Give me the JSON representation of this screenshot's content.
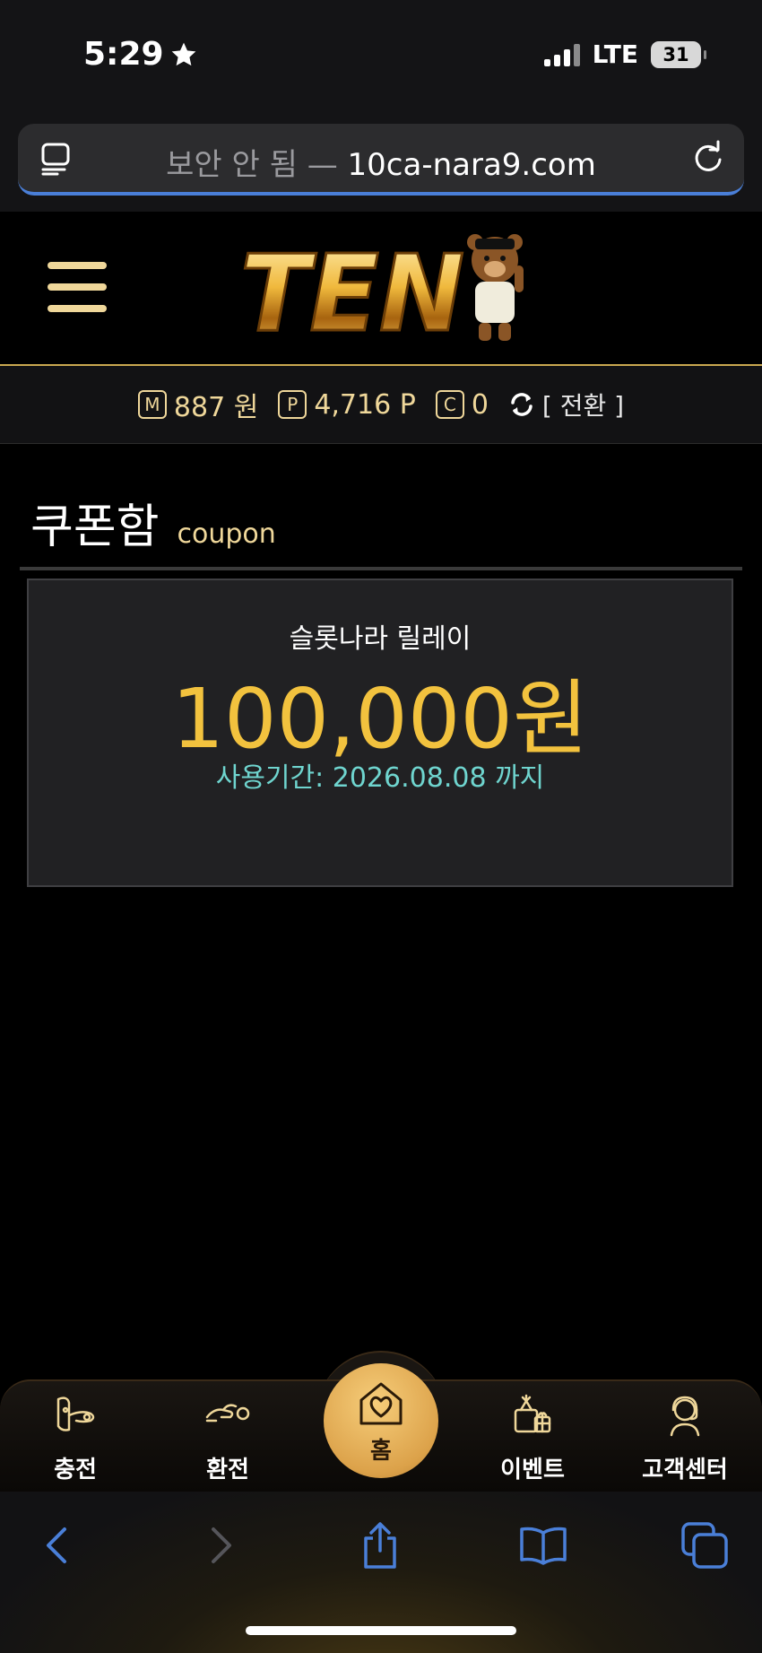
{
  "status_bar": {
    "time": "5:29",
    "network": "LTE",
    "battery": "31"
  },
  "browser": {
    "security_label": "보안 안 됨",
    "separator": " — ",
    "domain": "10ca-nara9.com"
  },
  "header": {
    "logo_text": "TEN"
  },
  "balance": {
    "money_letter": "M",
    "money": "887 원",
    "point_letter": "P",
    "points": "4,716 P",
    "coin_letter": "C",
    "coins": "0",
    "switch_label": "[ 전환 ]"
  },
  "page": {
    "title": "쿠폰함",
    "subtitle": "coupon"
  },
  "coupon": {
    "name": "슬롯나라 릴레이",
    "amount": "100,000원",
    "period": "사용기간: 2026.08.08 까지"
  },
  "bottom_nav": {
    "items": [
      {
        "label": "충전",
        "icon": "deposit-icon"
      },
      {
        "label": "환전",
        "icon": "withdraw-icon"
      },
      {
        "label": "홈",
        "icon": "home-heart-icon"
      },
      {
        "label": "이벤트",
        "icon": "gift-icon"
      },
      {
        "label": "고객센터",
        "icon": "support-icon"
      }
    ]
  },
  "colors": {
    "gold": "#efd79a",
    "amount": "#f2c23e",
    "period": "#6fd5cf",
    "link_blue": "#4a7fd8"
  }
}
